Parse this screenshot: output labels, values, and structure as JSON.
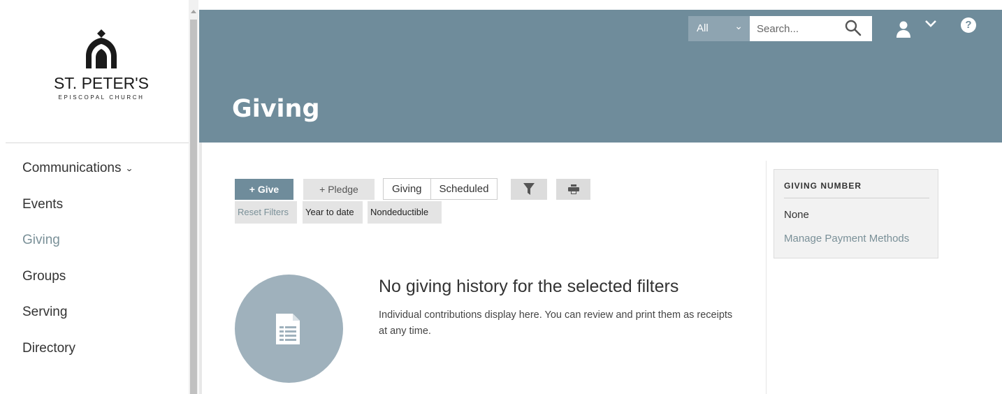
{
  "logo": {
    "title": "ST. PETER'S",
    "subtitle": "EPISCOPAL CHURCH"
  },
  "sidebar": {
    "items": [
      {
        "label": "Communications",
        "has_dropdown": true
      },
      {
        "label": "Events"
      },
      {
        "label": "Giving",
        "active": true
      },
      {
        "label": "Groups"
      },
      {
        "label": "Serving"
      },
      {
        "label": "Directory"
      }
    ]
  },
  "header": {
    "title": "Giving",
    "scope_select": "All",
    "search_placeholder": "Search...",
    "help_icon": "?",
    "color": "#6f8c9b"
  },
  "toolbar": {
    "give_label": "+ Give",
    "pledge_label": "+ Pledge",
    "tabs": [
      "Giving",
      "Scheduled"
    ],
    "filter_icon": "filter-icon",
    "print_icon": "print-icon"
  },
  "filters": {
    "reset_label": "Reset Filters",
    "chips": [
      "Year to date",
      "Nondeductible"
    ]
  },
  "empty_state": {
    "title": "No giving history for the selected filters",
    "description": "Individual contributions display here. You can review and print them as receipts at any time."
  },
  "panel": {
    "title": "GIVING NUMBER",
    "value": "None",
    "link": "Manage Payment Methods"
  },
  "colors": {
    "accent": "#6f8c9b",
    "link": "#7a9098",
    "empty_circle": "#9fb1bc"
  }
}
